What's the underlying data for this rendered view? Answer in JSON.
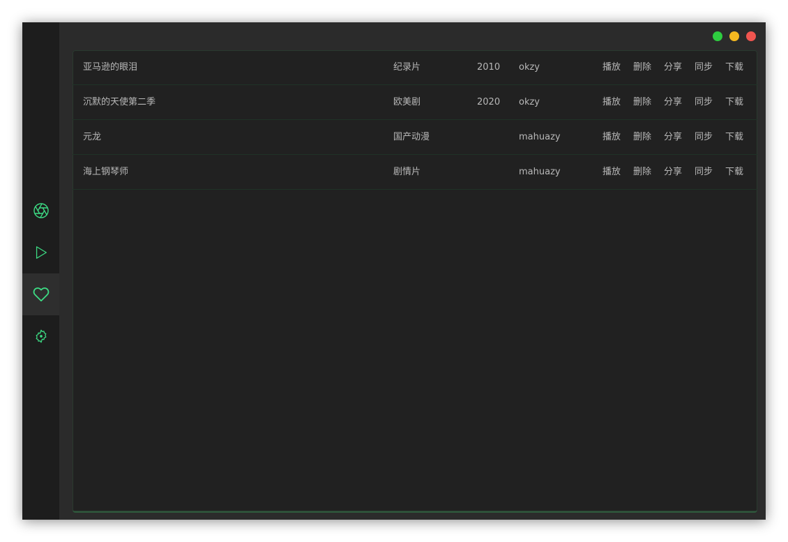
{
  "window_controls": {
    "colors": [
      "#2ecc40",
      "#f5b820",
      "#f0554f"
    ],
    "names": [
      "maximize",
      "minimize",
      "close"
    ]
  },
  "sidebar": {
    "accent": "#3ddc84",
    "active_index": 2,
    "items": [
      {
        "icon": "aperture-icon"
      },
      {
        "icon": "play-icon"
      },
      {
        "icon": "heart-icon"
      },
      {
        "icon": "gear-icon"
      }
    ]
  },
  "list": {
    "rows": [
      {
        "name": "亚马逊的眼泪",
        "type": "纪录片",
        "year": "2010",
        "source": "okzy"
      },
      {
        "name": "沉默的天使第二季",
        "type": "欧美剧",
        "year": "2020",
        "source": "okzy"
      },
      {
        "name": "元龙",
        "type": "国产动漫",
        "year": "",
        "source": "mahuazy"
      },
      {
        "name": "海上钢琴师",
        "type": "剧情片",
        "year": "",
        "source": "mahuazy"
      }
    ],
    "actions": [
      "播放",
      "删除",
      "分享",
      "同步",
      "下载"
    ]
  }
}
